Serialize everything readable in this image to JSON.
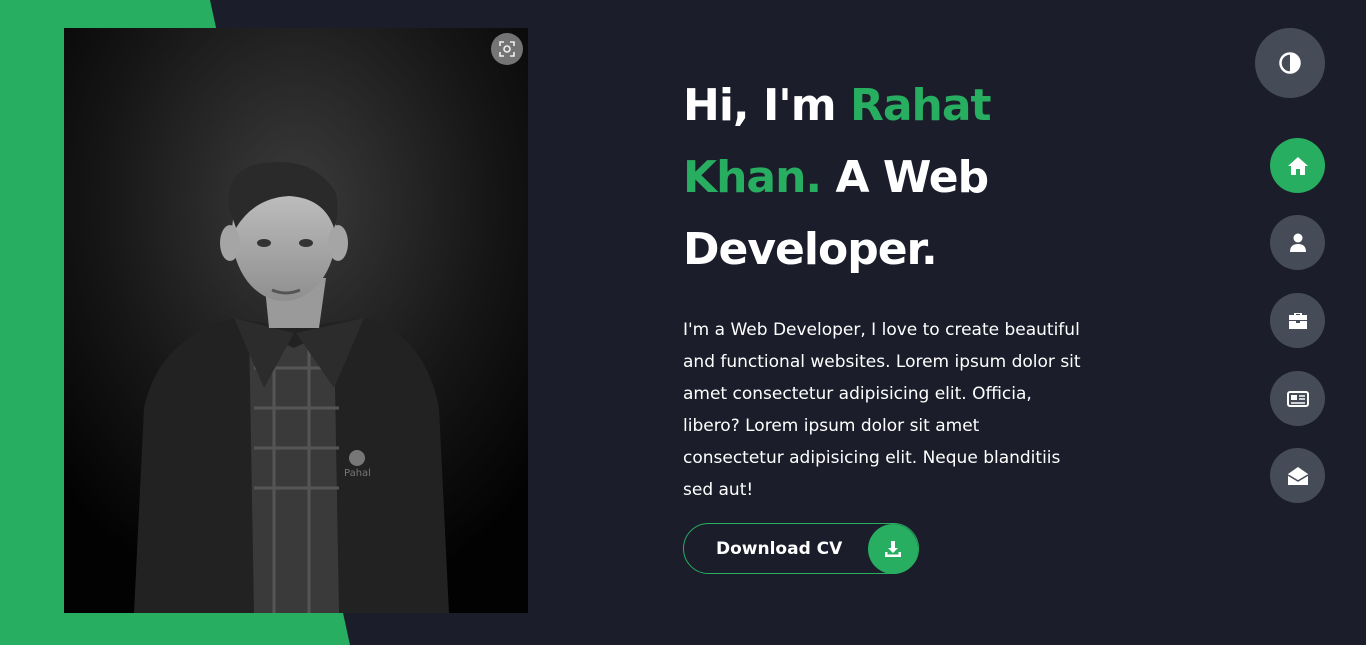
{
  "hero": {
    "greeting": "Hi, I'm ",
    "name": "Rahat Khan.",
    "role": " A Web Developer.",
    "bio": "I'm a Web Developer, I love to create beautiful and functional websites. Lorem ipsum dolor sit amet consectetur adipisicing elit. Officia, libero? Lorem ipsum dolor sit amet consectetur adipisicing elit. Neque blanditiis sed aut!",
    "cta_label": "Download CV",
    "cta_icon": "download-icon"
  },
  "photo": {
    "alt": "portrait-photo",
    "overlay_icon": "lens-scan-icon"
  },
  "theme_toggle": {
    "icon": "half-circle-contrast-icon"
  },
  "nav": {
    "items": [
      {
        "name": "home",
        "icon": "home-icon",
        "active": true
      },
      {
        "name": "about",
        "icon": "user-icon",
        "active": false
      },
      {
        "name": "portfolio",
        "icon": "briefcase-icon",
        "active": false
      },
      {
        "name": "blog",
        "icon": "newspaper-icon",
        "active": false
      },
      {
        "name": "contact",
        "icon": "envelope-open-icon",
        "active": false
      }
    ]
  },
  "colors": {
    "accent": "#27ae60",
    "background": "#1b1d2a",
    "button_grey": "#454c58",
    "text": "#ffffff"
  }
}
